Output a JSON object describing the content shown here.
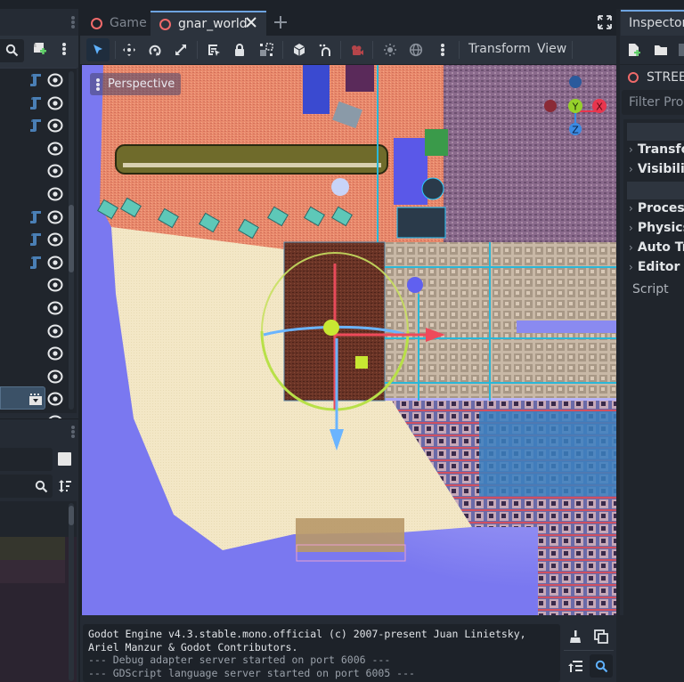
{
  "editor_tabs": [
    {
      "label": "Game",
      "icon": "scene-circle-icon",
      "active": false
    },
    {
      "label": "gnar_world",
      "icon": "scene-circle-icon",
      "active": true,
      "closable": true
    }
  ],
  "toolbar": {
    "tools": [
      "select-tool",
      "move-tool",
      "rotate-tool",
      "scale-tool",
      "list-select-tool",
      "lock-tool",
      "group-tool",
      "local-space-toggle",
      "snap-toggle",
      "camera-preview",
      "sun-toggle",
      "environment-toggle",
      "more-options"
    ],
    "menus": [
      "Transform",
      "View"
    ]
  },
  "viewport": {
    "perspective_label": "Perspective",
    "gizmo_axes": [
      "Y",
      "X",
      "Z"
    ],
    "colors": {
      "x": "#e8364e",
      "y": "#96d12b",
      "z": "#3b8be3"
    }
  },
  "scene_tree": {
    "rows": [
      {
        "script": true,
        "visible": true
      },
      {
        "script": true,
        "visible": true
      },
      {
        "script": true,
        "visible": true
      },
      {
        "script": false,
        "visible": true
      },
      {
        "script": false,
        "visible": true
      },
      {
        "script": false,
        "visible": true
      },
      {
        "script": true,
        "visible": true
      },
      {
        "script": true,
        "visible": true
      },
      {
        "script": true,
        "visible": true
      },
      {
        "script": false,
        "visible": true
      },
      {
        "script": false,
        "visible": true
      },
      {
        "script": false,
        "visible": true
      },
      {
        "script": false,
        "visible": true
      },
      {
        "script": false,
        "visible": true
      },
      {
        "clapper": true,
        "visible": true
      },
      {
        "selected": true,
        "visible": true
      }
    ]
  },
  "inspector": {
    "tab": "Inspector",
    "node_name": "STREET",
    "filter_placeholder": "Filter Properties",
    "sections": [
      "Transform",
      "Visibility",
      "Process",
      "Physics",
      "Auto Translate",
      "Editor Description"
    ],
    "script_label": "Script"
  },
  "output": {
    "lines": [
      {
        "text": "Godot Engine v4.3.stable.mono.official (c) 2007-present Juan Linietsky,",
        "style": "l1"
      },
      {
        "text": "Ariel Manzur & Godot Contributors.",
        "style": "l1"
      },
      {
        "text": "--- Debug adapter server started on port 6006 ---",
        "style": "l2"
      },
      {
        "text": "--- GDScript language server started on port 6005 ---",
        "style": "l2"
      }
    ]
  },
  "colors": {
    "accent": "#6ea4e0",
    "scene_icon": "#f06a6a"
  }
}
